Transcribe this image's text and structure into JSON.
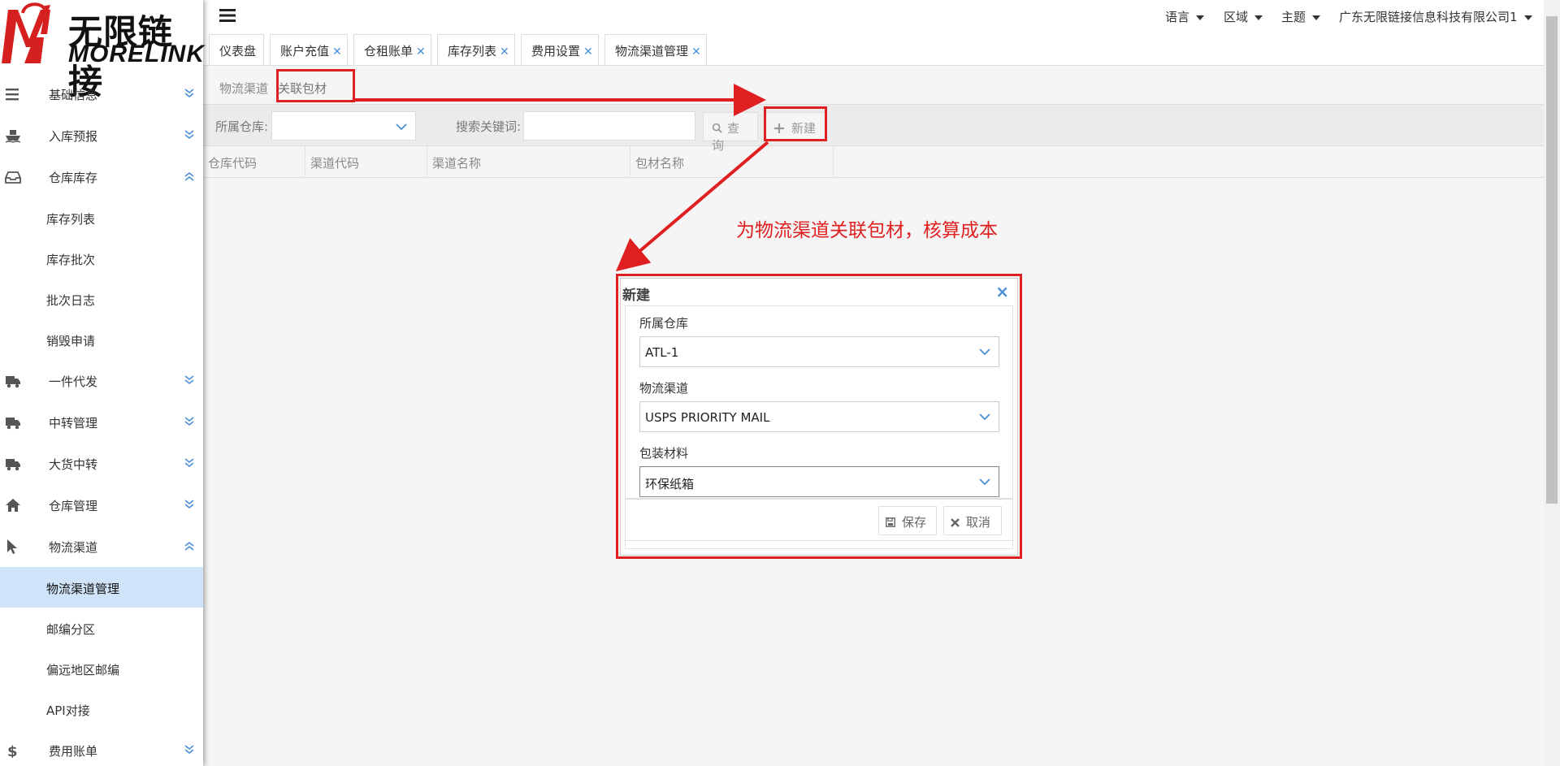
{
  "brand": {
    "name_cn": "无限链接",
    "name_en": "MORELINK",
    "color": "#d62020"
  },
  "sidebar": {
    "items": [
      {
        "label": "基础信息",
        "icon": "list-icon",
        "expanded": false
      },
      {
        "label": "入库预报",
        "icon": "ship-icon",
        "expanded": false
      },
      {
        "label": "仓库库存",
        "icon": "inbox-icon",
        "expanded": true
      },
      {
        "label": "库存列表"
      },
      {
        "label": "库存批次"
      },
      {
        "label": "批次日志"
      },
      {
        "label": "销毁申请"
      },
      {
        "label": "一件代发",
        "icon": "truck-icon",
        "expanded": false
      },
      {
        "label": "中转管理",
        "icon": "truck-icon",
        "expanded": false
      },
      {
        "label": "大货中转",
        "icon": "truck-icon",
        "expanded": false
      },
      {
        "label": "仓库管理",
        "icon": "home-icon",
        "expanded": false
      },
      {
        "label": "物流渠道",
        "icon": "cursor-icon",
        "expanded": true
      },
      {
        "label": "物流渠道管理",
        "active": true
      },
      {
        "label": "邮编分区"
      },
      {
        "label": "偏远地区邮编"
      },
      {
        "label": "API对接"
      },
      {
        "label": "费用账单",
        "icon": "dollar-icon",
        "expanded": false
      }
    ]
  },
  "topbar": {
    "language": "语言",
    "region": "区域",
    "theme": "主题",
    "company": "广东无限链接信息科技有限公司1"
  },
  "tabs": [
    {
      "label": "仪表盘",
      "closable": false
    },
    {
      "label": "账户充值",
      "closable": true
    },
    {
      "label": "仓租账单",
      "closable": true
    },
    {
      "label": "库存列表",
      "closable": true
    },
    {
      "label": "费用设置",
      "closable": true
    },
    {
      "label": "物流渠道管理",
      "closable": true
    }
  ],
  "subtabs": [
    {
      "label": "物流渠道"
    },
    {
      "label": "关联包材"
    }
  ],
  "filter": {
    "warehouse_label": "所属仓库:",
    "keyword_label": "搜索关键词:",
    "query_button": "查询",
    "new_button": "新建"
  },
  "table": {
    "columns": [
      "仓库代码",
      "渠道代码",
      "渠道名称",
      "包材名称"
    ]
  },
  "annotation": "为物流渠道关联包材，核算成本",
  "modal": {
    "title": "新建",
    "fields": [
      {
        "label": "所属仓库",
        "value": "ATL-1"
      },
      {
        "label": "物流渠道",
        "value": "USPS PRIORITY MAIL"
      },
      {
        "label": "包装材料",
        "value": "环保纸箱"
      }
    ],
    "save": "保存",
    "cancel": "取消"
  },
  "colors": {
    "accent": "#4a8fd8",
    "annotation": "#e02020",
    "active_bg": "#cfe3f9"
  }
}
